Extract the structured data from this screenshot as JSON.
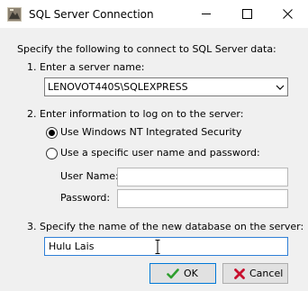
{
  "window": {
    "title": "SQL Server Connection",
    "icon": "sql-server-app-icon"
  },
  "titlebar_buttons": {
    "minimize": "minimize-icon",
    "maximize": "maximize-icon",
    "close": "close-icon"
  },
  "intro": {
    "text": "Specify the following to connect to SQL Server data:"
  },
  "step1": {
    "label": "1. Enter a server name:",
    "server_value": "LENOVOT440S\\SQLEXPRESS"
  },
  "step2": {
    "label": "2. Enter information to log on to the server:",
    "options": [
      {
        "label": "Use Windows NT Integrated Security",
        "selected": true
      },
      {
        "label": "Use a specific user name and password:",
        "selected": false
      }
    ],
    "user_name_label": "User Name:",
    "user_name_value": "",
    "password_label": "Password:",
    "password_value": ""
  },
  "step3": {
    "label": "3.  Specify the name of the new database on the server:",
    "database_value": "Hulu Lais"
  },
  "buttons": {
    "ok_label": "OK",
    "ok_icon": "green-checkmark-icon",
    "cancel_label": "Cancel",
    "cancel_icon": "red-x-icon"
  },
  "colors": {
    "focus_border": "#2f7fd6",
    "default_button_border": "#0078d7",
    "ok_icon": "#2e9e2e",
    "cancel_icon": "#c8102e"
  }
}
